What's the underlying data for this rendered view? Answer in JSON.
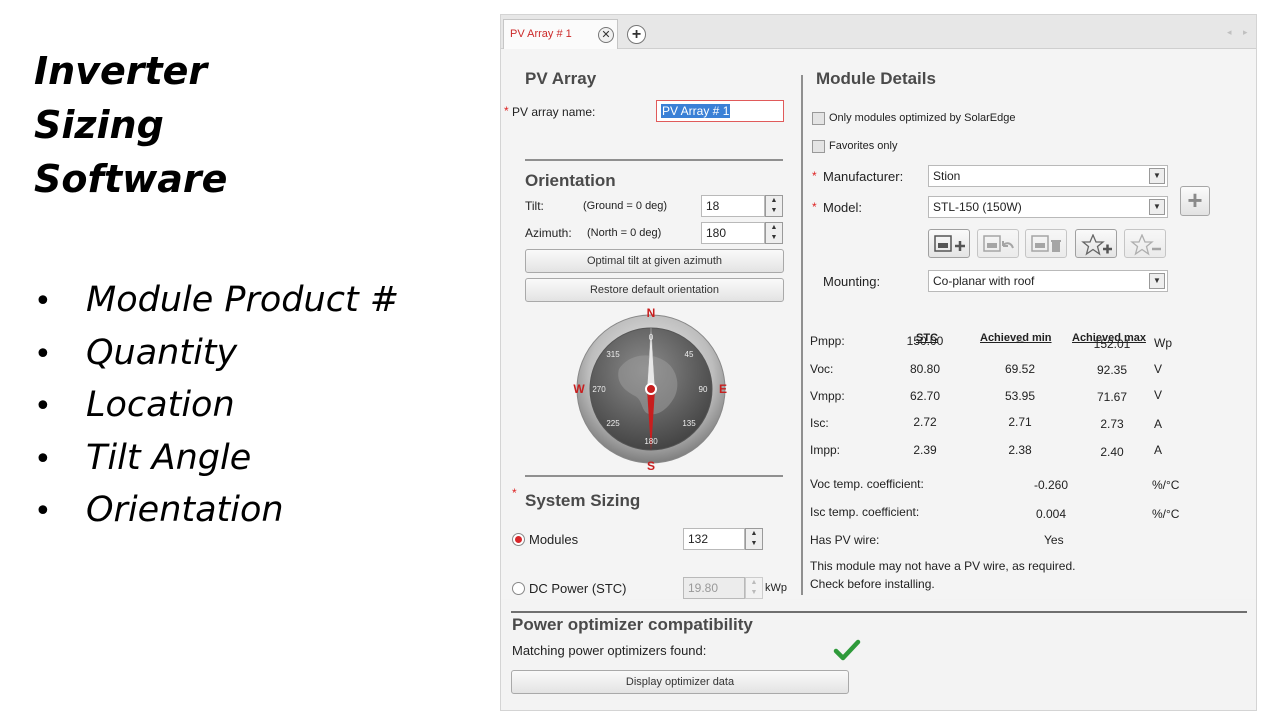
{
  "slide": {
    "title_lines": [
      "Inverter",
      "Sizing",
      "Software"
    ],
    "bullets": [
      "Module Product #",
      "Quantity",
      "Location",
      "Tilt Angle",
      "Orientation"
    ]
  },
  "tabs": {
    "active_label": "PV Array # 1",
    "close_glyph": "✕",
    "add_glyph": "+",
    "scroll_left": "◂",
    "scroll_right": "▸"
  },
  "pv_array": {
    "heading": "PV Array",
    "name_label": "PV array name:",
    "name_value": "PV Array # 1"
  },
  "orientation": {
    "heading": "Orientation",
    "tilt_label": "Tilt:",
    "tilt_hint": "(Ground = 0 deg)",
    "tilt_value": "18",
    "azimuth_label": "Azimuth:",
    "azimuth_hint": "(North = 0 deg)",
    "azimuth_value": "180",
    "optimal_tilt_button": "Optimal tilt at given azimuth",
    "restore_button": "Restore default orientation",
    "compass": {
      "N": "N",
      "S": "S",
      "E": "E",
      "W": "W",
      "deg0": "0",
      "deg45": "45",
      "deg90": "90",
      "deg135": "135",
      "deg180": "180",
      "deg225": "225",
      "deg270": "270",
      "deg315": "315"
    }
  },
  "system_sizing": {
    "heading": "System Sizing",
    "modules_label": "Modules",
    "modules_value": "132",
    "dc_power_label": "DC Power (STC)",
    "dc_power_value": "19.80",
    "dc_power_unit": "kWp"
  },
  "module_details": {
    "heading": "Module Details",
    "only_solaredge_label": "Only modules optimized by SolarEdge",
    "favorites_label": "Favorites only",
    "manufacturer_label": "Manufacturer:",
    "manufacturer_value": "Stion",
    "model_label": "Model:",
    "model_value": "STL-150 (150W)",
    "mounting_label": "Mounting:",
    "mounting_value": "Co-planar with roof",
    "columns": [
      "STC",
      "Achieved min",
      "Achieved max"
    ],
    "rows": [
      {
        "param": "Pmpp:",
        "stc": "150.00",
        "min": "--",
        "max": "152.01",
        "unit": "Wp"
      },
      {
        "param": "Voc:",
        "stc": "80.80",
        "min": "69.52",
        "max": "92.35",
        "unit": "V"
      },
      {
        "param": "Vmpp:",
        "stc": "62.70",
        "min": "53.95",
        "max": "71.67",
        "unit": "V"
      },
      {
        "param": "Isc:",
        "stc": "2.72",
        "min": "2.71",
        "max": "2.73",
        "unit": "A"
      },
      {
        "param": "Impp:",
        "stc": "2.39",
        "min": "2.38",
        "max": "2.40",
        "unit": "A"
      }
    ],
    "voc_temp_label": "Voc temp. coefficient:",
    "voc_temp_value": "-0.260",
    "voc_temp_unit": "%/°C",
    "isc_temp_label": "Isc temp. coefficient:",
    "isc_temp_value": "0.004",
    "isc_temp_unit": "%/°C",
    "pv_wire_label": "Has PV wire:",
    "pv_wire_value": "Yes",
    "warning_line1": "This module may not have a PV wire, as required.",
    "warning_line2": "Check before installing."
  },
  "optimizer": {
    "heading": "Power optimizer compatibility",
    "matching_label": "Matching power optimizers found:",
    "check_color": "#2e9a3a",
    "display_button": "Display optimizer data"
  },
  "colors": {
    "required": "#dd2222",
    "tab_text": "#cc2a2a",
    "compass_needle": "#c81e1e"
  }
}
